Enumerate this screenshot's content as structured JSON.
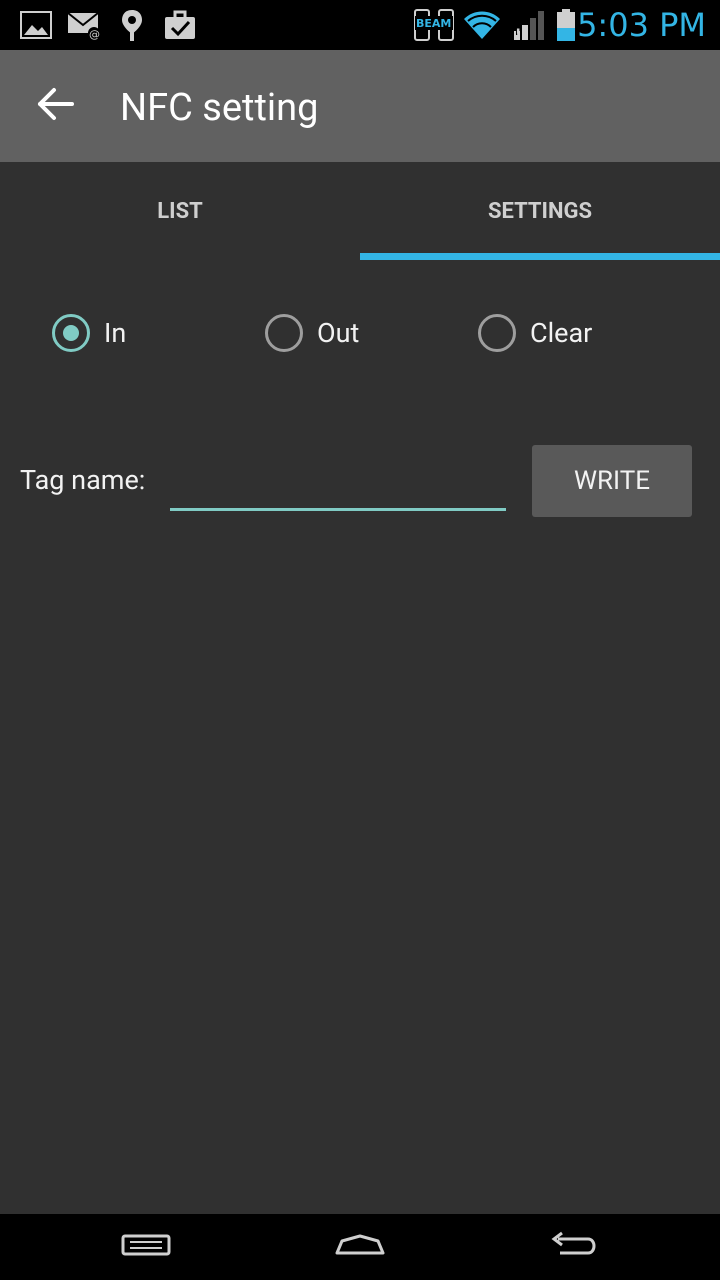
{
  "status_bar": {
    "time": "5:03 PM",
    "beam_label": "BEAM",
    "icons": [
      "gallery-icon",
      "email-icon",
      "location-icon",
      "task-icon",
      "nfc-beam-icon",
      "wifi-icon",
      "signal-icon",
      "battery-icon"
    ],
    "accent_color": "#33b5e5"
  },
  "action_bar": {
    "title": "NFC setting",
    "back_icon": "back-arrow-icon",
    "background": "#616161"
  },
  "tabs": [
    {
      "label": "LIST",
      "selected": false
    },
    {
      "label": "SETTINGS",
      "selected": true
    }
  ],
  "tab_indicator_color": "#33b5e5",
  "radio_group": [
    {
      "label": "In",
      "checked": true
    },
    {
      "label": "Out",
      "checked": false
    },
    {
      "label": "Clear",
      "checked": false
    }
  ],
  "tag": {
    "label": "Tag name:",
    "value": "",
    "button_label": "WRITE"
  },
  "accent_teal": "#80cbc4",
  "nav_bar": {
    "icons": [
      "recent-apps-icon",
      "home-icon",
      "back-icon"
    ]
  }
}
